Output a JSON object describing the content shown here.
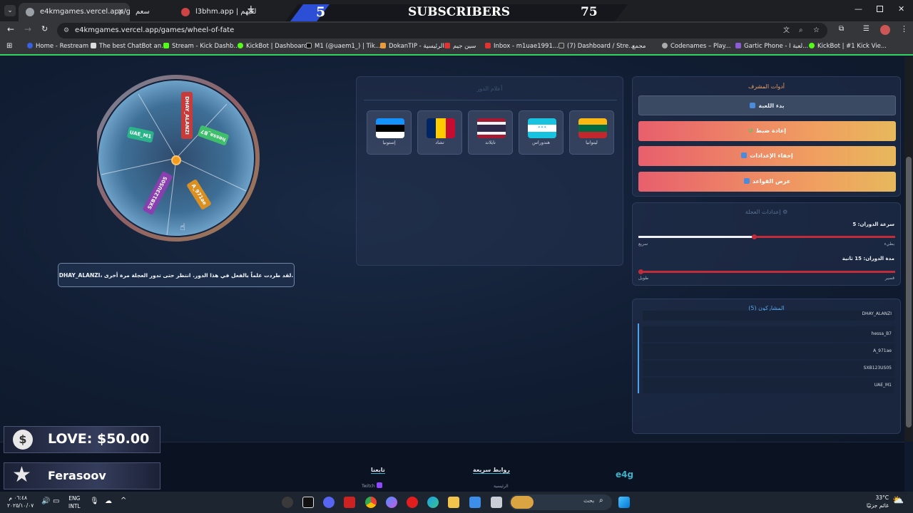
{
  "browser": {
    "tabs": [
      {
        "title": "e4kmgames.vercel.app/games/",
        "active": true
      },
      {
        "title": "سعم",
        "active": false
      },
      {
        "title": "l3bhm.app | لعبهم",
        "active": false
      }
    ],
    "url": "e4kmgames.vercel.app/games/wheel-of-fate",
    "bookmarks": [
      "Home - Restream",
      "The best ChatBot an...",
      "Stream - Kick Dashb...",
      "KickBot | Dashboard",
      "M1 (@uaem1_) | Tik...",
      "DokanTIP - الرئيسية",
      "سين جيم",
      "Inbox - m1uae1991...",
      "(7) Dashboard / Stre...",
      "مجمع",
      "Codenames – Play...",
      "Gartic Phone - لعبة ا...",
      "KickBot | #1 Kick Vie..."
    ],
    "colors": {
      "accent_green": "#2fd55f"
    }
  },
  "stream_overlay": {
    "left_count": "5",
    "label": "SUBSCRIBERS",
    "right_count": "75",
    "love": "LOVE: $50.00",
    "name": "Ferasoov"
  },
  "wheel": {
    "segments": [
      {
        "name": "DHAY_ALANZI",
        "color": "#c83b3b"
      },
      {
        "name": "UAE_M1",
        "color": "#2bb38a"
      },
      {
        "name": "hessa_B7",
        "color": "#3fbf6c"
      },
      {
        "name": "SXB123US05",
        "color": "#8a3fb0"
      },
      {
        "name": "A_971ae",
        "color": "#d98f22"
      }
    ],
    "message": "DHAY_ALANZI، لقد طردت علماً بالفعل في هذا الدور. انتظر حتى تدور العجلة مرة أخرى."
  },
  "flags_panel": {
    "title": "أعلام الدور",
    "flags": [
      {
        "label": "إستونيا",
        "icon": "estonia-flag"
      },
      {
        "label": "تشاد",
        "icon": "chad-flag"
      },
      {
        "label": "تايلاند",
        "icon": "thailand-flag"
      },
      {
        "label": "هندوراس",
        "icon": "honduras-flag"
      },
      {
        "label": "ليتوانيا",
        "icon": "lithuania-flag"
      }
    ]
  },
  "admin_tools": {
    "title": "أدوات المشرف",
    "start": "بدء اللعبة",
    "reset": "إعادة ضبط",
    "hide_settings": "إخفاء الإعدادات",
    "rules": "عرض القواعد"
  },
  "wheel_settings": {
    "title": "إعدادات العجلة ⚙",
    "speed_label": "سرعة الدوران: 5",
    "speed_min": "سريع",
    "speed_max": "بطيء",
    "speed_value": 5,
    "speed_fraction": 0.45,
    "duration_label": "مدة الدوران: 15 ثانية",
    "duration_min": "طويل",
    "duration_max": "قصير",
    "duration_fraction": 1.0
  },
  "participants": {
    "title": "المشاركون (5)",
    "items": [
      "DHAY_ALANZI",
      "hessa_B7",
      "A_971ae",
      "SXB123US05",
      "UAE_M1"
    ]
  },
  "footer": {
    "brand": "e4g",
    "quick_links": "روابط سريعة",
    "home": "الرئيسية",
    "follow": "تابعنا",
    "twitch": "Twitch"
  },
  "taskbar": {
    "time": "٠٦:٤٨ م",
    "date": "٢٠٢٥/١٠/٠٧",
    "lang1": "ENG",
    "lang2": "INTL",
    "search": "بحث",
    "temp": "33°C",
    "weather": "غائم جزئيًا"
  }
}
